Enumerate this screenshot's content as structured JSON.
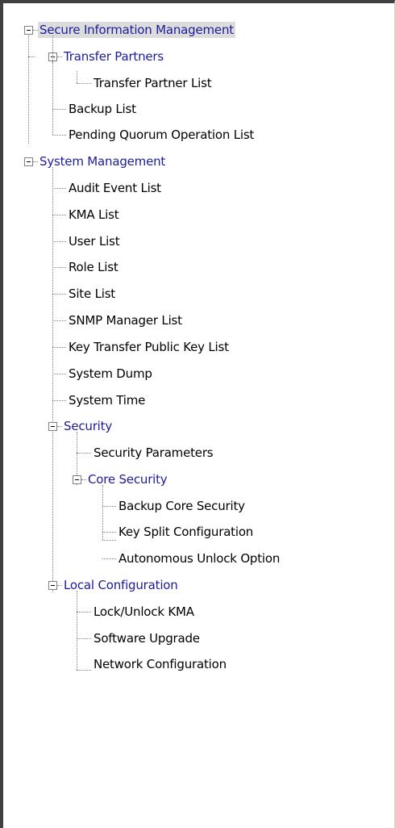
{
  "tree": {
    "secure_info": {
      "label": "Secure Information Management",
      "transfer_partners": {
        "label": "Transfer Partners",
        "items": [
          "Transfer Partner List"
        ]
      },
      "items": [
        "Backup List",
        "Pending Quorum Operation List"
      ]
    },
    "system_mgmt": {
      "label": "System Management",
      "items": [
        "Audit Event List",
        "KMA List",
        "User List",
        "Role List",
        "Site List",
        "SNMP Manager List",
        "Key Transfer Public Key List",
        "System Dump",
        "System Time"
      ],
      "security": {
        "label": "Security",
        "items": [
          "Security Parameters"
        ],
        "core_security": {
          "label": "Core Security",
          "items": [
            "Backup Core Security",
            "Key Split Configuration",
            "Autonomous Unlock Option"
          ]
        }
      },
      "local_config": {
        "label": "Local Configuration",
        "items": [
          "Lock/Unlock KMA",
          "Software Upgrade",
          "Network Configuration"
        ]
      }
    }
  },
  "colors": {
    "folder_text": "#1c1c9a",
    "selection": "#dcdcdc",
    "connector": "#808080"
  }
}
